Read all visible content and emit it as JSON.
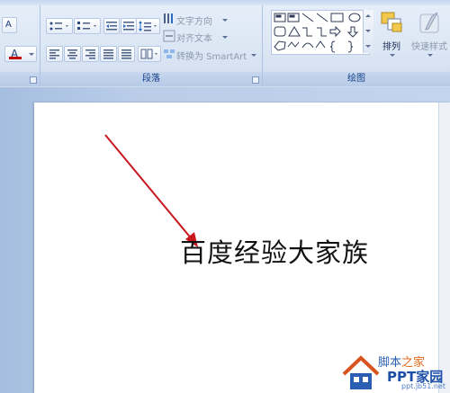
{
  "ribbon": {
    "paragraph_group_label": "段落",
    "drawing_group_label": "绘图",
    "text_direction_label": "文字方向",
    "align_text_label": "对齐文本",
    "convert_smartart_label": "转换为 SmartArt",
    "arrange_label": "排列",
    "quick_styles_label": "快速样式"
  },
  "slide": {
    "text": "百度经验大家族",
    "arrow_color": "#c8161e"
  },
  "watermark": {
    "line1_a": "脚本",
    "line1_b": "之家",
    "line2": "PPT家园",
    "line3": "ppt.jb51.net"
  }
}
